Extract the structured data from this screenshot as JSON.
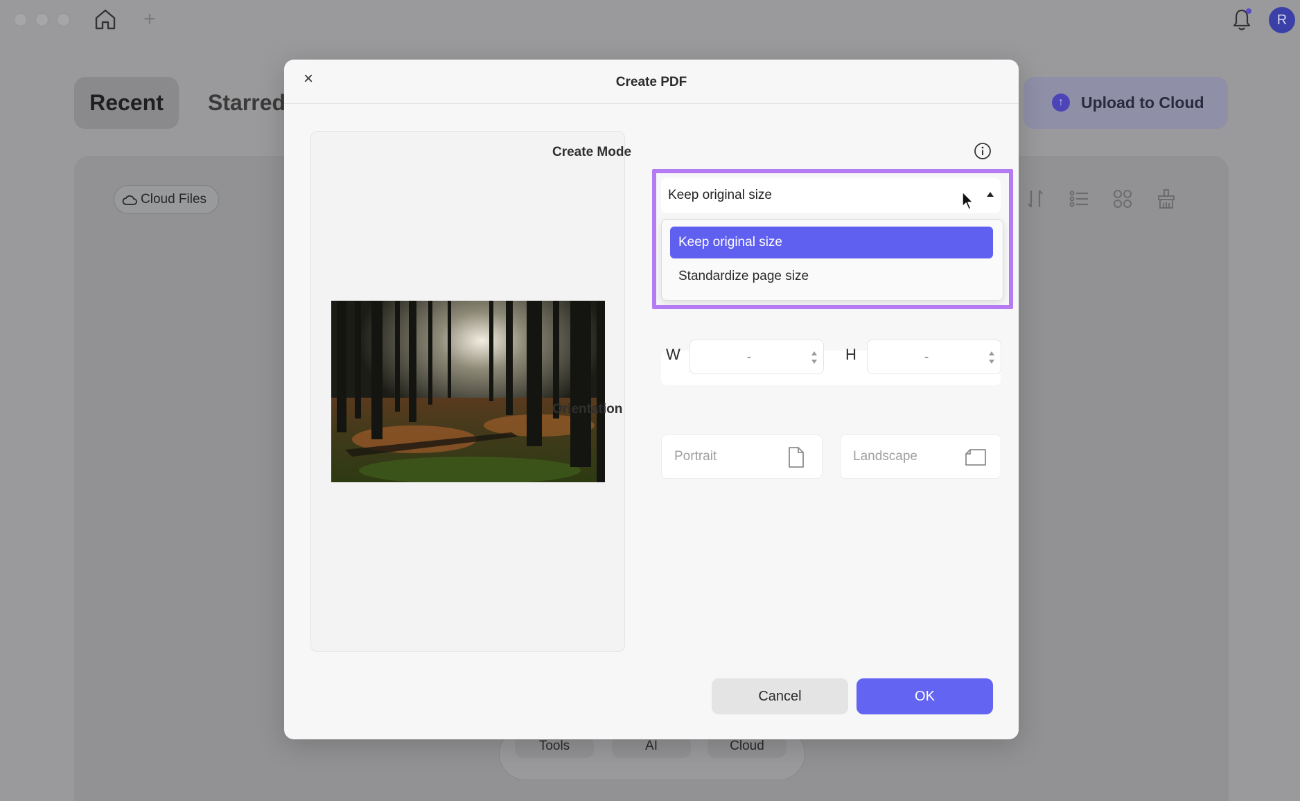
{
  "titlebar": {
    "avatar_initial": "R",
    "plus_symbol": "+",
    "icons": [
      "home-icon",
      "bell-icon"
    ]
  },
  "tabs": {
    "recent": "Recent",
    "starred": "Starred"
  },
  "upload": {
    "label": "Upload to Cloud",
    "icon": "up-arrow-icon"
  },
  "content": {
    "cloud_files_label": "Cloud Files",
    "toolbar_icons": [
      "sort-icon",
      "list-view-icon",
      "grid-view-icon",
      "clean-icon"
    ]
  },
  "bottom_bar": {
    "items": [
      "Tools",
      "AI",
      "Cloud"
    ]
  },
  "modal": {
    "title": "Create PDF",
    "close_symbol": "×",
    "create_mode_label": "Create Mode",
    "select_value": "Keep original size",
    "dropdown_options": [
      {
        "label": "Keep original size",
        "selected": true
      },
      {
        "label": "Standardize page size",
        "selected": false
      }
    ],
    "width_label": "W",
    "width_value": "-",
    "height_label": "H",
    "height_value": "-",
    "orientation_label": "Orientation",
    "portrait_label": "Portrait",
    "landscape_label": "Landscape",
    "cancel_label": "Cancel",
    "ok_label": "OK"
  },
  "colors": {
    "accent": "#6464f2",
    "highlight_border": "#b57bf2",
    "overlay_bg": "#9a9a9c"
  }
}
